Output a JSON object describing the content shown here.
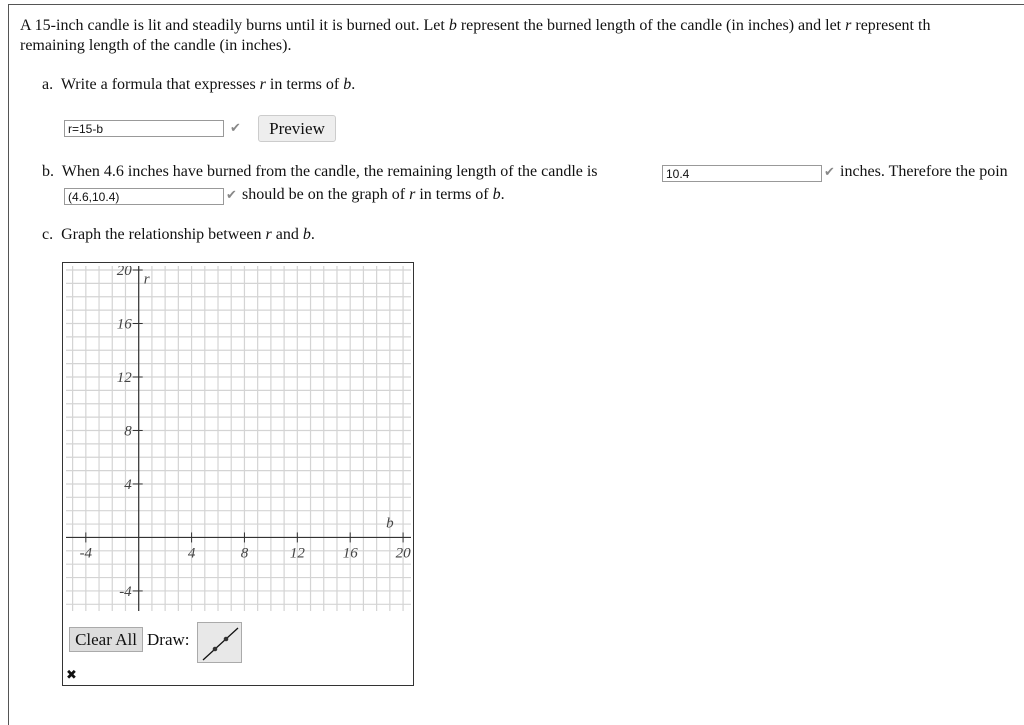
{
  "problem": {
    "intro_1": "A 15-inch candle is lit and steadily burns until it is burned out. Let ",
    "var_b": "b",
    "intro_2": " represent the burned length of the candle (in inches) and let ",
    "var_r": "r",
    "intro_3": " represent th",
    "intro_line2": "remaining length of the candle (in inches)."
  },
  "part_a": {
    "label": "a.",
    "text": "Write a formula that expresses ",
    "var_r": "r",
    "mid": " in terms of ",
    "var_b": "b",
    "end": ".",
    "answer": "r=15-b",
    "preview_label": "Preview"
  },
  "part_b": {
    "label": "b.",
    "text": "When 4.6 inches have burned from the candle, the remaining length of the candle is",
    "answer1": "10.4",
    "after1": "inches. Therefore the poin",
    "answer2": "(4.6,10.4)",
    "after2": "should be on the graph of ",
    "var_r": "r",
    "mid": " in terms of ",
    "var_b": "b",
    "end": "."
  },
  "part_c": {
    "label": "c.",
    "text": "Graph the relationship between ",
    "var_r": "r",
    "mid": " and ",
    "var_b": "b",
    "end": "."
  },
  "graph": {
    "x_axis_label": "b",
    "y_axis_label": "r",
    "xlim": [
      -5.5,
      20.6
    ],
    "ylim": [
      -5.5,
      20.3
    ],
    "x_ticks": [
      -4,
      4,
      8,
      12,
      16,
      20
    ],
    "y_ticks": [
      -4,
      4,
      8,
      12,
      16,
      20
    ],
    "x_tick_labels": [
      "-4",
      "4",
      "8",
      "12",
      "16",
      "20"
    ],
    "y_tick_labels": [
      "-4",
      "4",
      "8",
      "12",
      "16",
      "20"
    ],
    "grid_color": "#d4d4d4"
  },
  "controls": {
    "clear_all": "Clear All",
    "draw_label": "Draw:",
    "draw_tool_icon": "line-segment-icon",
    "status_icon": "x-mark-icon",
    "status_symbol": "✖"
  }
}
